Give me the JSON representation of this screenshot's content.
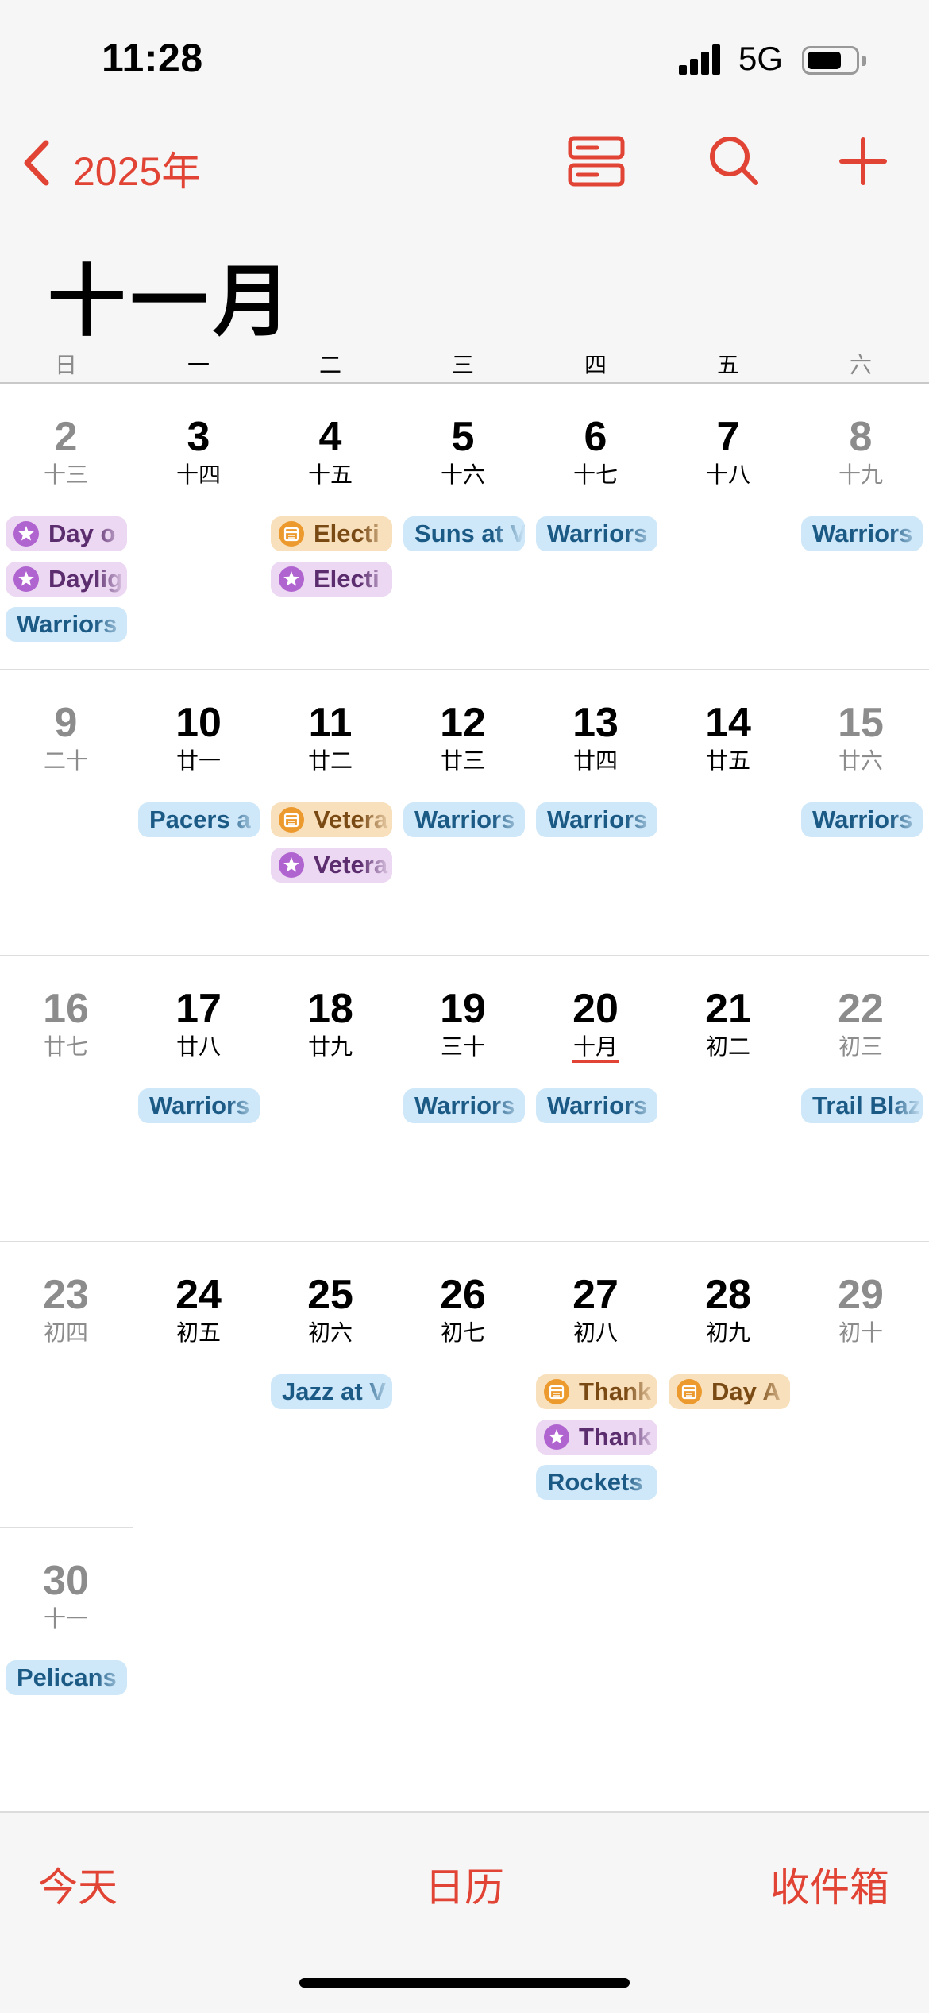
{
  "status_bar": {
    "time": "11:28",
    "network": "5G"
  },
  "nav": {
    "year_label": "2025年"
  },
  "month_title": "十一月",
  "weekdays": [
    "日",
    "一",
    "二",
    "三",
    "四",
    "五",
    "六"
  ],
  "colors": {
    "accent": "#e14434",
    "event_blue": "#cfe8f9",
    "event_purple": "#ecd8f2",
    "event_orange": "#f9e0bc"
  },
  "weeks": [
    {
      "days": [
        {
          "num": "2",
          "lunar": "十三",
          "weekend": true,
          "events": [
            {
              "type": "purple",
              "icon": "star-icon",
              "label": "Day o"
            },
            {
              "type": "purple",
              "icon": "star-icon",
              "label": "Daylig"
            },
            {
              "type": "blue",
              "label": "Warriors"
            }
          ]
        },
        {
          "num": "3",
          "lunar": "十四",
          "events": []
        },
        {
          "num": "4",
          "lunar": "十五",
          "events": [
            {
              "type": "orange",
              "icon": "calendar-icon",
              "label": "Electi"
            },
            {
              "type": "purple",
              "icon": "star-icon",
              "label": "Electi"
            }
          ]
        },
        {
          "num": "5",
          "lunar": "十六",
          "events": [
            {
              "type": "blue",
              "label": "Suns at V"
            }
          ]
        },
        {
          "num": "6",
          "lunar": "十七",
          "events": [
            {
              "type": "blue",
              "label": "Warriors"
            }
          ]
        },
        {
          "num": "7",
          "lunar": "十八",
          "events": []
        },
        {
          "num": "8",
          "lunar": "十九",
          "weekend": true,
          "events": [
            {
              "type": "blue",
              "label": "Warriors"
            }
          ]
        }
      ]
    },
    {
      "days": [
        {
          "num": "9",
          "lunar": "二十",
          "weekend": true,
          "events": []
        },
        {
          "num": "10",
          "lunar": "廿一",
          "events": [
            {
              "type": "blue",
              "label": "Pacers a"
            }
          ]
        },
        {
          "num": "11",
          "lunar": "廿二",
          "events": [
            {
              "type": "orange",
              "icon": "calendar-icon",
              "label": "Vetera"
            },
            {
              "type": "purple",
              "icon": "star-icon",
              "label": "Vetera"
            }
          ]
        },
        {
          "num": "12",
          "lunar": "廿三",
          "events": [
            {
              "type": "blue",
              "label": "Warriors"
            }
          ]
        },
        {
          "num": "13",
          "lunar": "廿四",
          "events": [
            {
              "type": "blue",
              "label": "Warriors"
            }
          ]
        },
        {
          "num": "14",
          "lunar": "廿五",
          "events": []
        },
        {
          "num": "15",
          "lunar": "廿六",
          "weekend": true,
          "events": [
            {
              "type": "blue",
              "label": "Warriors"
            }
          ]
        }
      ]
    },
    {
      "days": [
        {
          "num": "16",
          "lunar": "廿七",
          "weekend": true,
          "events": []
        },
        {
          "num": "17",
          "lunar": "廿八",
          "events": [
            {
              "type": "blue",
              "label": "Warriors"
            }
          ]
        },
        {
          "num": "18",
          "lunar": "廿九",
          "events": []
        },
        {
          "num": "19",
          "lunar": "三十",
          "events": [
            {
              "type": "blue",
              "label": "Warriors"
            }
          ]
        },
        {
          "num": "20",
          "lunar": "十月",
          "today": true,
          "events": [
            {
              "type": "blue",
              "label": "Warriors"
            }
          ]
        },
        {
          "num": "21",
          "lunar": "初二",
          "events": []
        },
        {
          "num": "22",
          "lunar": "初三",
          "weekend": true,
          "events": [
            {
              "type": "blue",
              "label": "Trail Blaz"
            }
          ]
        }
      ]
    },
    {
      "days": [
        {
          "num": "23",
          "lunar": "初四",
          "weekend": true,
          "events": []
        },
        {
          "num": "24",
          "lunar": "初五",
          "events": []
        },
        {
          "num": "25",
          "lunar": "初六",
          "events": [
            {
              "type": "blue",
              "label": "Jazz at V"
            }
          ]
        },
        {
          "num": "26",
          "lunar": "初七",
          "events": []
        },
        {
          "num": "27",
          "lunar": "初八",
          "events": [
            {
              "type": "orange",
              "icon": "calendar-icon",
              "label": "Thank"
            },
            {
              "type": "purple",
              "icon": "star-icon",
              "label": "Thank"
            },
            {
              "type": "blue",
              "label": "Rockets"
            }
          ]
        },
        {
          "num": "28",
          "lunar": "初九",
          "events": [
            {
              "type": "orange",
              "icon": "calendar-icon",
              "label": "Day A"
            }
          ]
        },
        {
          "num": "29",
          "lunar": "初十",
          "weekend": true,
          "events": []
        }
      ]
    },
    {
      "days": [
        {
          "num": "30",
          "lunar": "十一",
          "weekend": true,
          "events": [
            {
              "type": "blue",
              "label": "Pelicans"
            }
          ]
        }
      ]
    }
  ],
  "bottom_bar": {
    "today": "今天",
    "calendars": "日历",
    "inbox": "收件箱"
  }
}
